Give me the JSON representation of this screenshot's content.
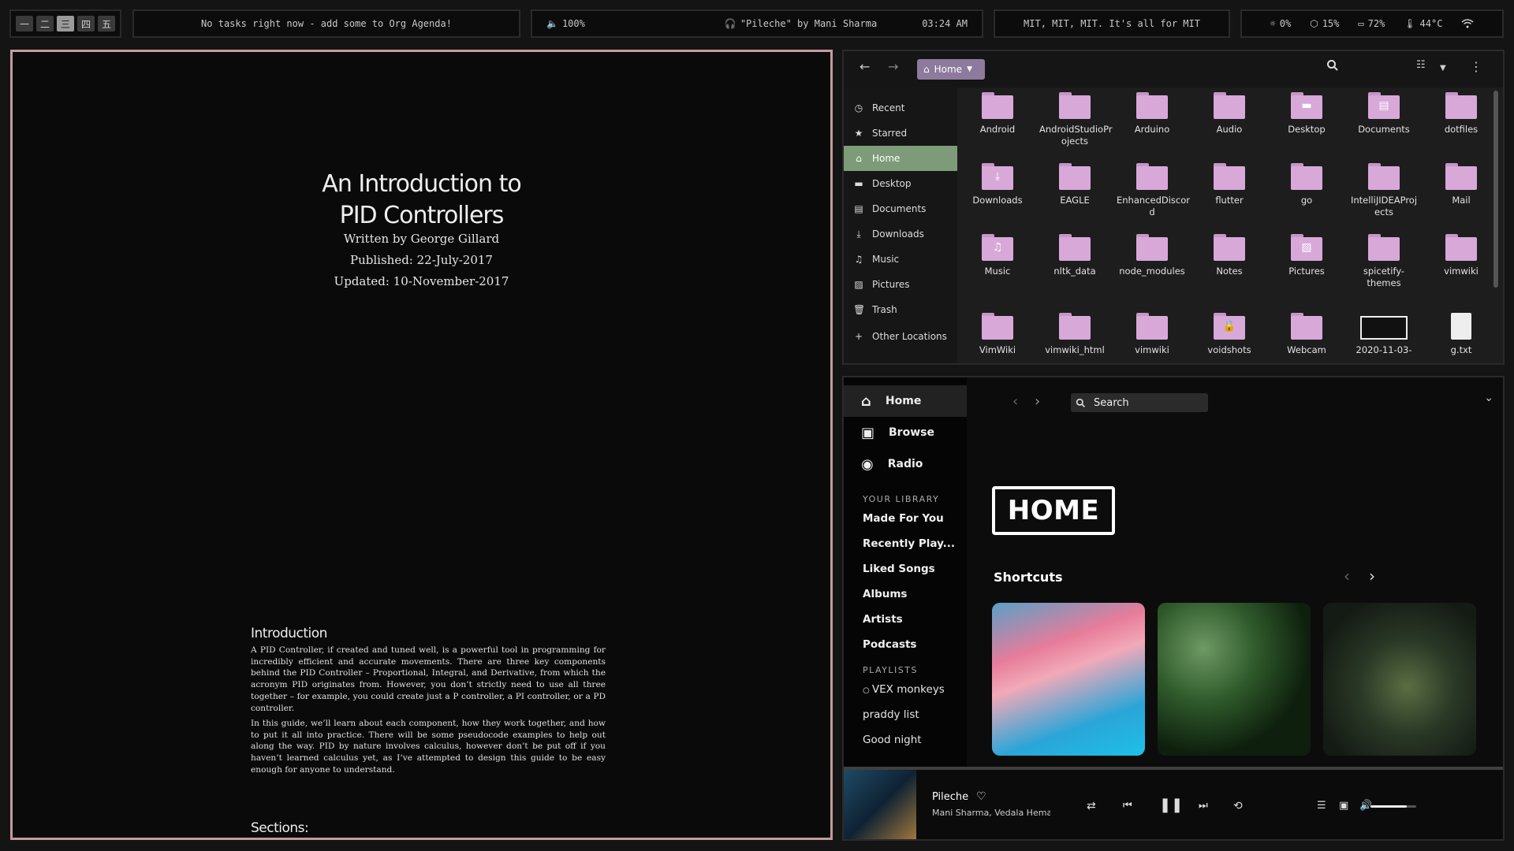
{
  "topbar": {
    "workspaces": [
      "一",
      "二",
      "三",
      "四",
      "五"
    ],
    "active_workspace": 2,
    "agenda": "No tasks right now - add some to Org Agenda!",
    "volume": "100%",
    "now_playing": "\"Pileche\" by Mani Sharma",
    "time": "03:24 AM",
    "motto": "MIT, MIT, MIT. It's all for MIT",
    "brightness": "0%",
    "cpu": "15%",
    "battery": "72%",
    "temperature": "44°C"
  },
  "document": {
    "title_line1": "An Introduction to",
    "title_line2": "PID Controllers",
    "author": "Written by George Gillard",
    "published": "Published: 22-July-2017",
    "updated": "Updated: 10-November-2017",
    "intro_heading": "Introduction",
    "intro_p1": "A PID Controller, if created and tuned well, is a powerful tool in programming for incredibly efficient and accurate movements. There are three key components behind the PID Controller – Proportional, Integral, and Derivative, from which the acronym PID originates from. However, you don’t strictly need to use all three together – for example, you could create just a P controller, a PI controller, or a PD controller.",
    "intro_p2": "In this guide, we’ll learn about each component, how they work together, and how to put it all into practice. There will be some pseudocode examples to help out along the way. PID by nature involves calculus, however don’t be put off if you haven’t learned calculus yet, as I’ve attempted to design this guide to be easy enough for anyone to understand.",
    "sections_heading": "Sections:"
  },
  "file_manager": {
    "breadcrumb": "Home",
    "sidebar": [
      {
        "label": "Recent",
        "icon": "clock-icon"
      },
      {
        "label": "Starred",
        "icon": "star-icon"
      },
      {
        "label": "Home",
        "icon": "home-icon"
      },
      {
        "label": "Desktop",
        "icon": "desktop-icon"
      },
      {
        "label": "Documents",
        "icon": "document-icon"
      },
      {
        "label": "Downloads",
        "icon": "download-icon"
      },
      {
        "label": "Music",
        "icon": "music-icon"
      },
      {
        "label": "Pictures",
        "icon": "picture-icon"
      },
      {
        "label": "Trash",
        "icon": "trash-icon"
      },
      {
        "label": "Other Locations",
        "icon": "plus-icon"
      }
    ],
    "active_sidebar": 2,
    "files": [
      {
        "name": "Android",
        "type": "folder"
      },
      {
        "name": "AndroidStudioPr ojects",
        "type": "folder"
      },
      {
        "name": "Arduino",
        "type": "folder"
      },
      {
        "name": "Audio",
        "type": "folder"
      },
      {
        "name": "Desktop",
        "type": "folder-desktop"
      },
      {
        "name": "Documents",
        "type": "folder-documents"
      },
      {
        "name": "dotfiles",
        "type": "folder"
      },
      {
        "name": "Downloads",
        "type": "folder-downloads"
      },
      {
        "name": "EAGLE",
        "type": "folder"
      },
      {
        "name": "EnhancedDiscor d",
        "type": "folder"
      },
      {
        "name": "flutter",
        "type": "folder"
      },
      {
        "name": "go",
        "type": "folder"
      },
      {
        "name": "IntelliJIDEAProj ects",
        "type": "folder"
      },
      {
        "name": "Mail",
        "type": "folder"
      },
      {
        "name": "Music",
        "type": "folder-music"
      },
      {
        "name": "nltk_data",
        "type": "folder"
      },
      {
        "name": "node_modules",
        "type": "folder"
      },
      {
        "name": "Notes",
        "type": "folder"
      },
      {
        "name": "Pictures",
        "type": "folder-pictures"
      },
      {
        "name": "spicetify-themes",
        "type": "folder"
      },
      {
        "name": "vimwiki",
        "type": "folder"
      },
      {
        "name": "VimWiki",
        "type": "folder"
      },
      {
        "name": "vimwiki_html",
        "type": "folder"
      },
      {
        "name": "vimwiki",
        "type": "folder"
      },
      {
        "name": "voidshots",
        "type": "folder-locked"
      },
      {
        "name": "Webcam",
        "type": "folder"
      },
      {
        "name": "2020-11-03-",
        "type": "image"
      },
      {
        "name": "g.txt",
        "type": "text"
      }
    ]
  },
  "spotify": {
    "nav": [
      "Home",
      "Browse",
      "Radio"
    ],
    "library_heading": "YOUR LIBRARY",
    "library": [
      "Made For You",
      "Recently Play...",
      "Liked Songs",
      "Albums",
      "Artists",
      "Podcasts"
    ],
    "playlists_heading": "PLAYLISTS",
    "playlists": [
      "VEX monkeys",
      "praddy list",
      "Good night"
    ],
    "search_placeholder": "Search",
    "home_badge": "HOME",
    "shortcuts_heading": "Shortcuts",
    "track_title": "Pileche",
    "track_artists": "Mani Sharma, Vedala Hemac",
    "volume_level": 0.8
  },
  "colors": {
    "document_border": "#c49aa0",
    "folder": "#d8a8d9",
    "sidebar_active": "#7d9b78",
    "breadcrumb": "#8d7a9c"
  }
}
